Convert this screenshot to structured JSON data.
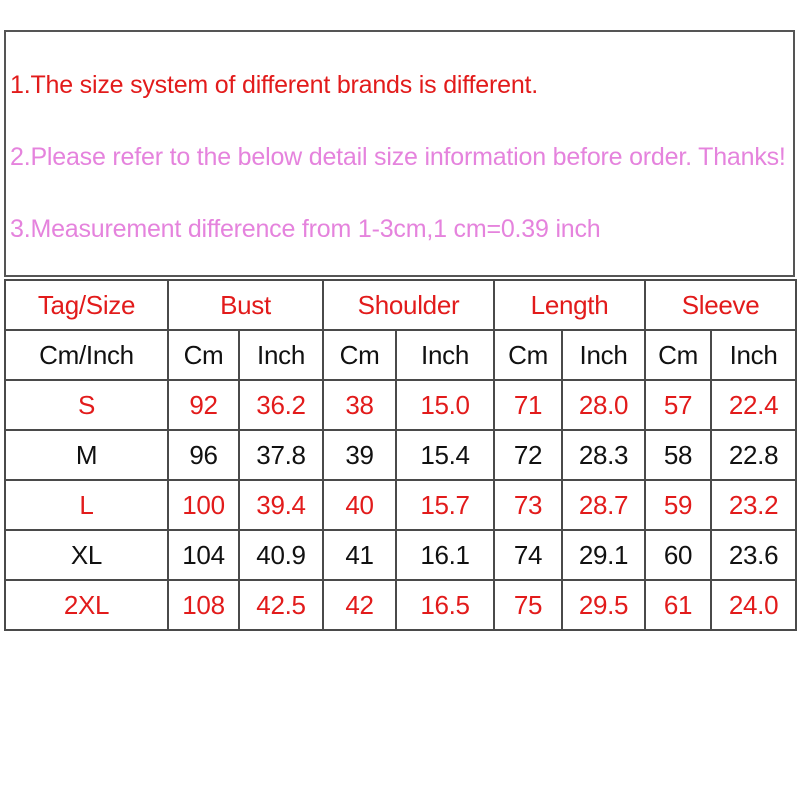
{
  "colors": {
    "note_primary": "#e21b1b",
    "note_secondary": "#e583dd",
    "header_text": "#e21b1b",
    "row_red": "#e21b1b",
    "row_black": "#111111",
    "border": "#4a4a4a",
    "background": "#ffffff"
  },
  "notes": {
    "line1": "1.The size system of different brands is different.",
    "line2": "2.Please refer to the below detail size information before order. Thanks!",
    "line3": "3.Measurement difference from 1-3cm,1 cm=0.39 inch"
  },
  "table": {
    "group_headers": {
      "size": "Tag/Size",
      "bust": "Bust",
      "shoulder": "Shoulder",
      "length": "Length",
      "sleeve": "Sleeve"
    },
    "unit_headers": {
      "size": "Cm/Inch",
      "bust_cm": "Cm",
      "bust_inch": "Inch",
      "shoulder_cm": "Cm",
      "shoulder_inch": "Inch",
      "length_cm": "Cm",
      "length_inch": "Inch",
      "sleeve_cm": "Cm",
      "sleeve_inch": "Inch"
    },
    "rows": [
      {
        "size": "S",
        "color": "red",
        "bust_cm": "92",
        "bust_inch": "36.2",
        "shoulder_cm": "38",
        "shoulder_inch": "15.0",
        "length_cm": "71",
        "length_inch": "28.0",
        "sleeve_cm": "57",
        "sleeve_inch": "22.4"
      },
      {
        "size": "M",
        "color": "black",
        "bust_cm": "96",
        "bust_inch": "37.8",
        "shoulder_cm": "39",
        "shoulder_inch": "15.4",
        "length_cm": "72",
        "length_inch": "28.3",
        "sleeve_cm": "58",
        "sleeve_inch": "22.8"
      },
      {
        "size": "L",
        "color": "red",
        "bust_cm": "100",
        "bust_inch": "39.4",
        "shoulder_cm": "40",
        "shoulder_inch": "15.7",
        "length_cm": "73",
        "length_inch": "28.7",
        "sleeve_cm": "59",
        "sleeve_inch": "23.2"
      },
      {
        "size": "XL",
        "color": "black",
        "bust_cm": "104",
        "bust_inch": "40.9",
        "shoulder_cm": "41",
        "shoulder_inch": "16.1",
        "length_cm": "74",
        "length_inch": "29.1",
        "sleeve_cm": "60",
        "sleeve_inch": "23.6"
      },
      {
        "size": "2XL",
        "color": "red",
        "bust_cm": "108",
        "bust_inch": "42.5",
        "shoulder_cm": "42",
        "shoulder_inch": "16.5",
        "length_cm": "75",
        "length_inch": "29.5",
        "sleeve_cm": "61",
        "sleeve_inch": "24.0"
      }
    ]
  }
}
